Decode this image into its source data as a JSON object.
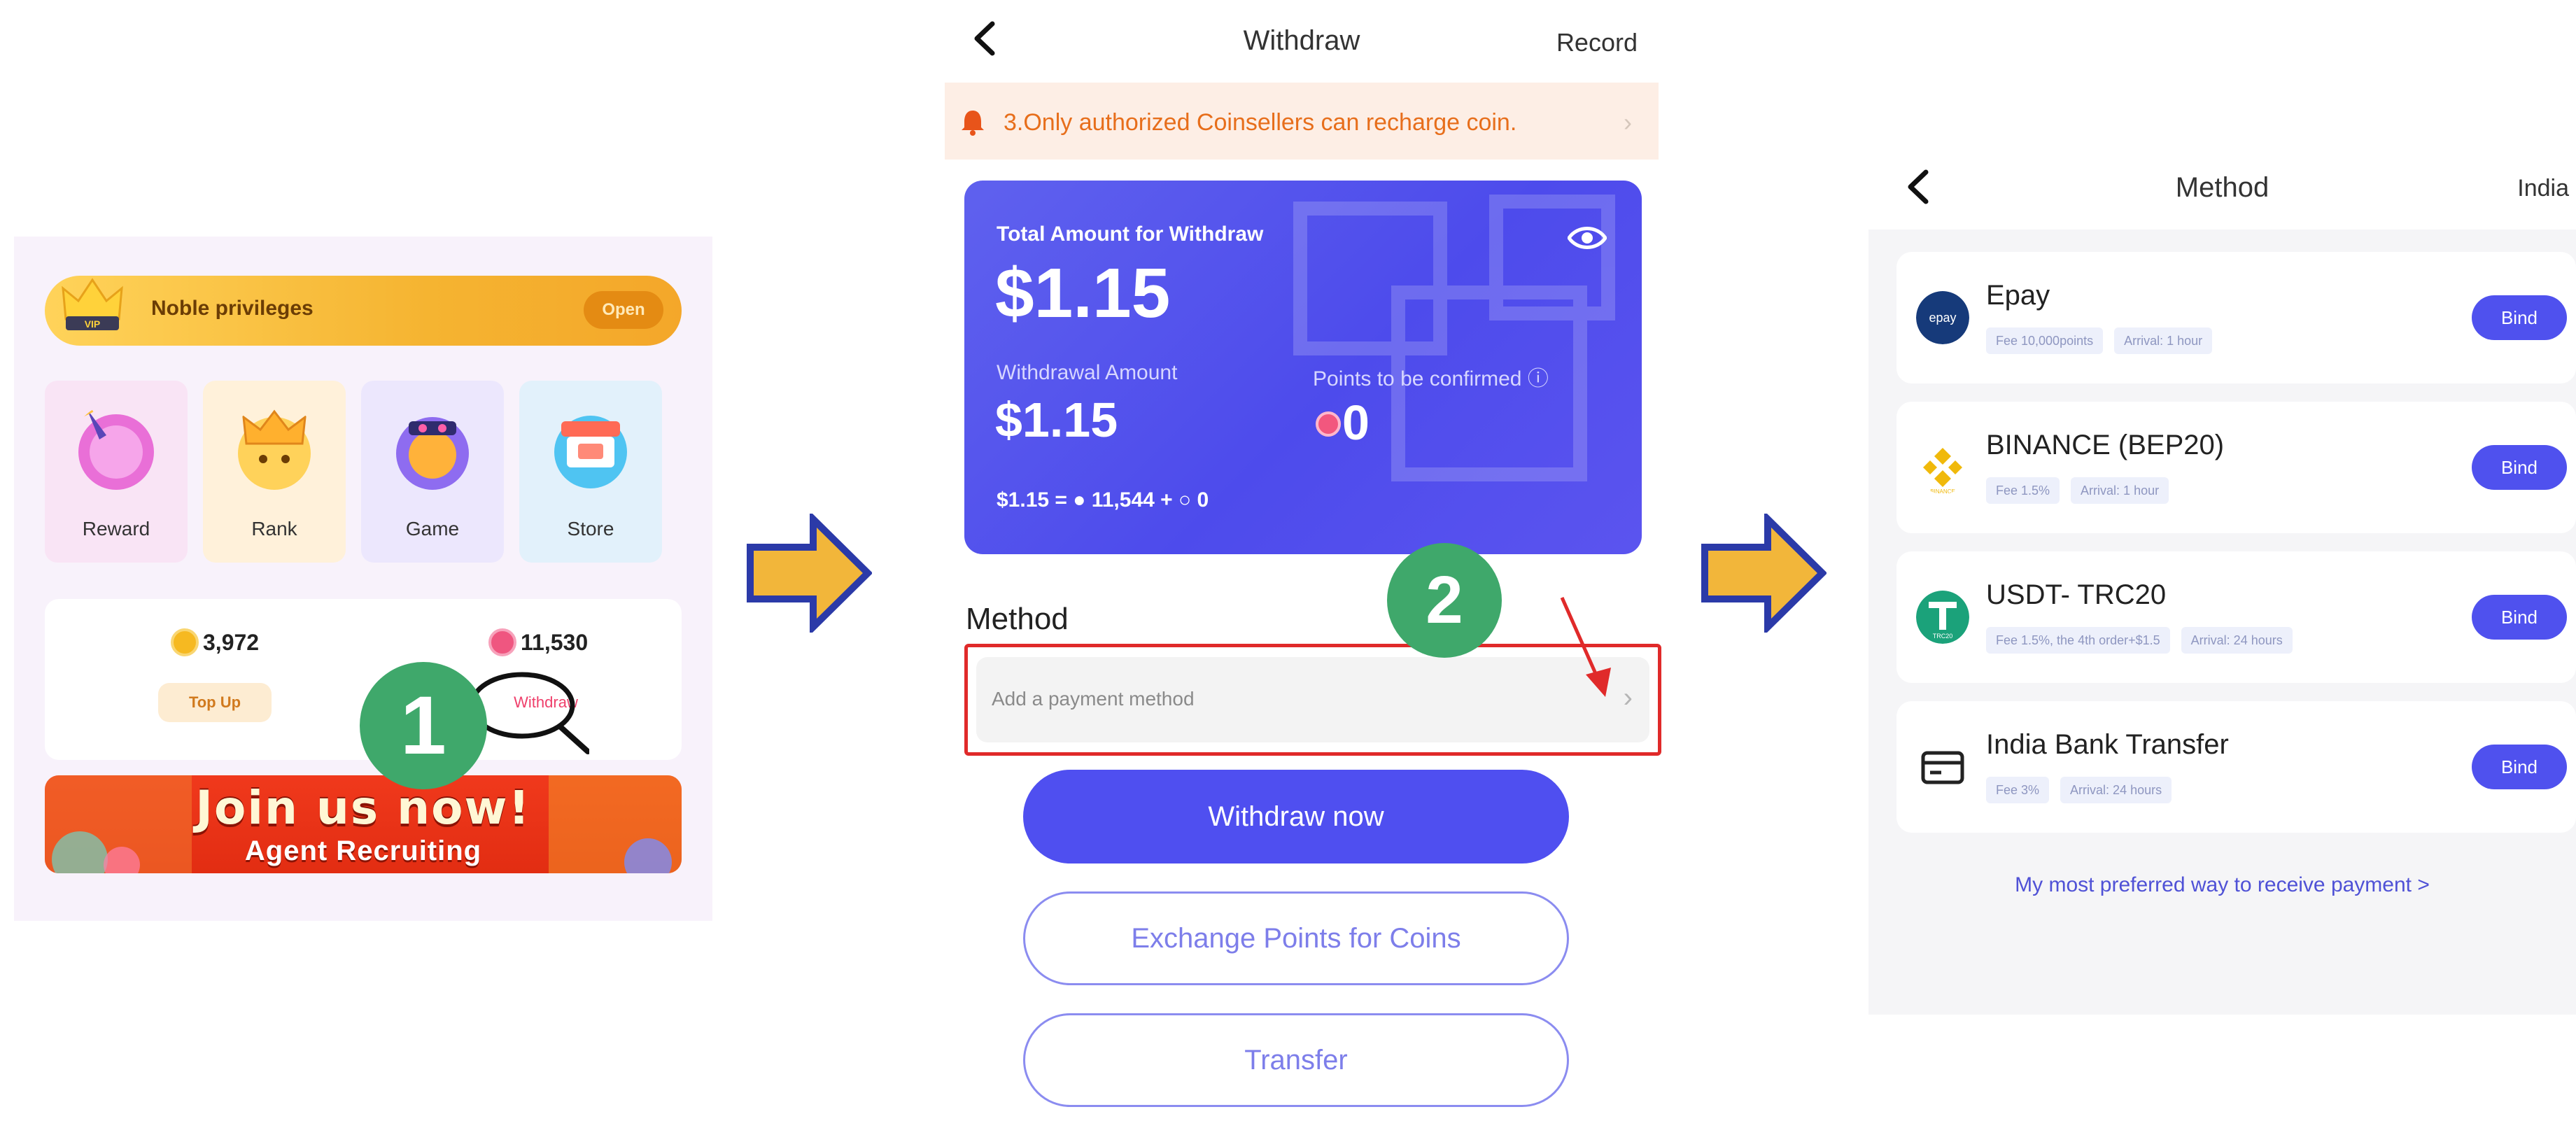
{
  "panel1": {
    "noble": {
      "title": "Noble privileges",
      "open_label": "Open",
      "vip_label": "VIP"
    },
    "tiles": [
      {
        "label": "Reward",
        "color": "#e96fd7"
      },
      {
        "label": "Rank",
        "color": "#ffc23d"
      },
      {
        "label": "Game",
        "color": "#8e6cf0"
      },
      {
        "label": "Store",
        "color": "#4fc4f2"
      }
    ],
    "wallet": {
      "coins": "3,972",
      "points": "11,530",
      "top_up_label": "Top Up",
      "withdraw_label": "Withdraw"
    },
    "banner": {
      "line1": "Join us now!",
      "line2": "Agent Recruiting"
    },
    "step_badge": "1"
  },
  "panel2": {
    "header": {
      "title": "Withdraw",
      "record": "Record"
    },
    "notice": "3.Only authorized Coinsellers can recharge coin.",
    "card": {
      "total_label": "Total Amount for Withdraw",
      "total_value": "$1.15",
      "withdrawal_label": "Withdrawal Amount",
      "withdrawal_value": "$1.15",
      "points_label": "Points to be confirmed",
      "points_value": "0",
      "rate_text": "$1.15 = ● 11,544 + ○ 0"
    },
    "method_label": "Method",
    "payment_placeholder": "Add a payment method",
    "step_badge": "2",
    "buttons": {
      "withdraw_now": "Withdraw now",
      "exchange": "Exchange Points for Coins",
      "transfer": "Transfer"
    }
  },
  "panel3": {
    "header": {
      "title": "Method",
      "region": "India"
    },
    "methods": [
      {
        "name": "Epay",
        "tags": [
          "Fee 10,000points",
          "Arrival: 1 hour"
        ],
        "bind": "Bind",
        "logo_icon": "epay-logo-icon",
        "logo_text": "epay"
      },
      {
        "name": "BINANCE (BEP20)",
        "tags": [
          "Fee 1.5%",
          "Arrival: 1 hour"
        ],
        "bind": "Bind",
        "logo_icon": "binance-logo-icon",
        "logo_text": "BINANCE"
      },
      {
        "name": "USDT- TRC20",
        "tags": [
          "Fee 1.5%, the 4th order+$1.5",
          "Arrival: 24 hours"
        ],
        "bind": "Bind",
        "logo_icon": "tether-logo-icon",
        "logo_text": "TRC20"
      },
      {
        "name": "India Bank Transfer",
        "tags": [
          "Fee 3%",
          "Arrival: 24 hours"
        ],
        "bind": "Bind",
        "logo_icon": "bank-card-icon",
        "logo_text": ""
      }
    ],
    "preferred_link": "My most preferred way to receive payment >"
  },
  "colors": {
    "accent": "#4f4ff0",
    "highlight_red": "#e02a2a",
    "step_green": "#3fa86b",
    "arrow_gold": "#f2b63a",
    "arrow_blue": "#2b3aa8"
  }
}
